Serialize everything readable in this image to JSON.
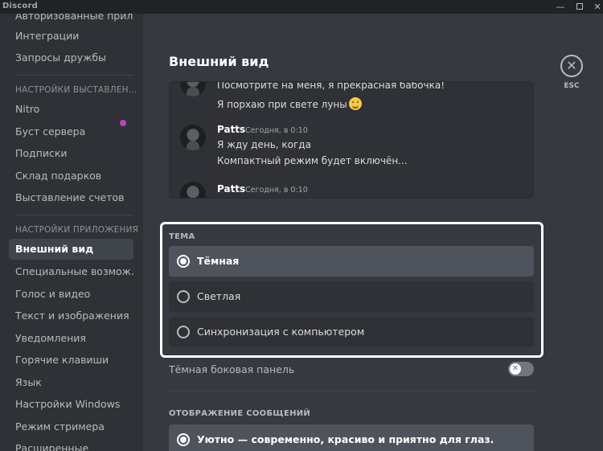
{
  "window": {
    "app_title": "Discord",
    "controls": {
      "minimize": "—",
      "maximize_icon": "square",
      "close": "✕"
    }
  },
  "sidebar": {
    "items_top": [
      {
        "label": "Авторизованные прил..."
      },
      {
        "label": "Интеграции"
      },
      {
        "label": "Запросы дружбы"
      }
    ],
    "billing_header": "НАСТРОЙКИ ВЫСТАВЛЕН...",
    "billing_items": [
      {
        "label": "Nitro",
        "badge_color": "#b845c1"
      },
      {
        "label": "Буст сервера"
      },
      {
        "label": "Подписки"
      },
      {
        "label": "Склад подарков"
      },
      {
        "label": "Выставление счетов"
      }
    ],
    "app_header": "НАСТРОЙКИ ПРИЛОЖЕНИЯ",
    "app_items": [
      {
        "label": "Внешний вид",
        "active": true
      },
      {
        "label": "Специальные возмож..."
      },
      {
        "label": "Голос и видео"
      },
      {
        "label": "Текст и изображения"
      },
      {
        "label": "Уведомления"
      },
      {
        "label": "Горячие клавиши"
      },
      {
        "label": "Язык"
      },
      {
        "label": "Настройки Windows"
      },
      {
        "label": "Режим стримера"
      },
      {
        "label": "Расширенные"
      }
    ]
  },
  "main": {
    "title": "Внешний вид",
    "close": {
      "icon": "close-icon",
      "glyph": "✕",
      "label": "ESC"
    },
    "preview": {
      "messages": [
        {
          "lines": [
            "Посмотрите на меня, я прекрасная бабочка!",
            "Я порхаю при свете луны"
          ],
          "emoji": "slightly-smiling-face"
        },
        {
          "author": "Patts",
          "time": "Сегодня, в 0:10",
          "lines": [
            "Я жду день, когда",
            "Компактный режим будет включён..."
          ]
        },
        {
          "author": "Patts",
          "time": "Сегодня, в 0:10",
          "lines": []
        }
      ]
    },
    "theme": {
      "header": "ТЕМА",
      "options": [
        {
          "label": "Тёмная",
          "selected": true
        },
        {
          "label": "Светлая",
          "selected": false
        },
        {
          "label": "Синхронизация с компьютером",
          "selected": false
        }
      ]
    },
    "dark_sidebar": {
      "label": "Тёмная боковая панель",
      "enabled": false,
      "knob_glyph": "✕"
    },
    "message_display": {
      "header": "ОТОБРАЖЕНИЕ СООБЩЕНИЙ",
      "options": [
        {
          "label": "Уютно — современно, красиво и приятно для глаз.",
          "selected": true
        }
      ]
    }
  },
  "colors": {
    "background": "#202225",
    "sidebar": "#2f3136",
    "content": "#36393f",
    "selected": "#4f545c",
    "highlight_border": "#ffffff"
  }
}
